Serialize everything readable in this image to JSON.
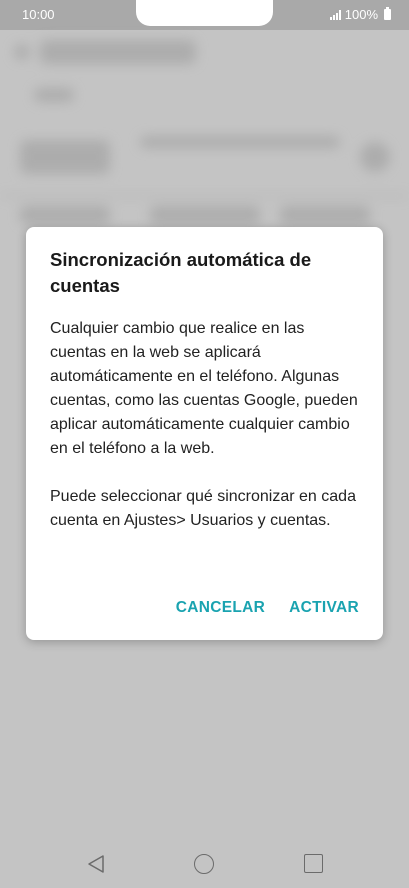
{
  "status_bar": {
    "time": "10:00",
    "battery": "100%",
    "signal_icon": "signal-icon",
    "battery_icon": "battery-icon"
  },
  "dialog": {
    "title": "Sincronización automática de cuentas",
    "paragraphs": [
      "Cualquier cambio que realice en las cuentas en la web se aplicará automáticamente en el teléfono. Algunas cuentas, como las cuentas Google, pueden aplicar automáticamente cualquier cambio en el teléfono a la web.",
      "Puede seleccionar qué sincronizar en cada cuenta en Ajustes> Usuarios y cuentas."
    ],
    "cancel_label": "CANCELAR",
    "confirm_label": "ACTIVAR",
    "accent_color": "#1aa3b0"
  },
  "navigation_bar": {
    "back_icon": "back-icon",
    "home_icon": "home-icon",
    "recents_icon": "recents-icon"
  }
}
